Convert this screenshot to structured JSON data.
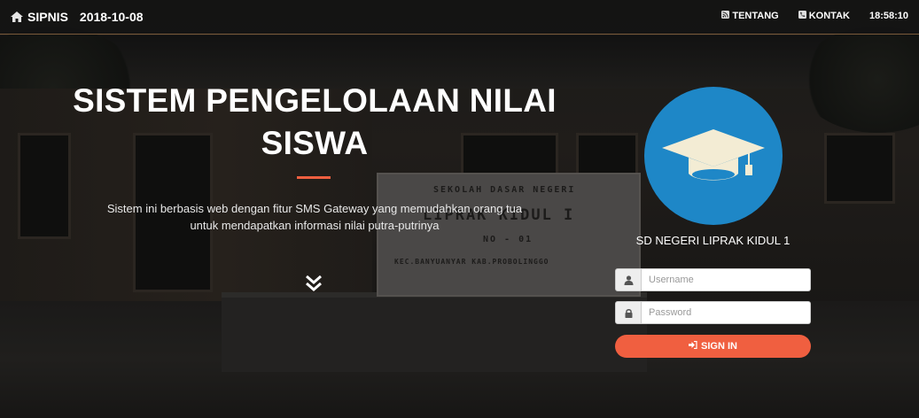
{
  "navbar": {
    "brand": "SIPNIS",
    "date": "2018-10-08",
    "links": [
      {
        "label": "TENTANG",
        "icon": "rss-icon"
      },
      {
        "label": "KONTAK",
        "icon": "phone-icon"
      }
    ],
    "clock": "18:58:10"
  },
  "hero": {
    "title_line1": "SISTEM PENGELOLAAN NILAI",
    "title_line2": "SISWA",
    "subtitle_line1": "Sistem ini berbasis web dengan fitur SMS Gateway yang memudahkan orang tua",
    "subtitle_line2": "untuk mendapatkan informasi nilai putra-putrinya",
    "scroll_icon": "double-chevron-down-icon"
  },
  "background_sign": {
    "line1": "SEKOLAH DASAR NEGERI",
    "line2": "LIPRAK KIDUL I",
    "line3": "NO - 01",
    "line4": "KEC.BANYUANYAR KAB.PROBOLINGGO"
  },
  "login": {
    "logo_icon": "graduation-cap-icon",
    "school_name": "SD NEGERI LIPRAK KIDUL 1",
    "username_placeholder": "Username",
    "password_placeholder": "Password",
    "signin_label": "SIGN IN"
  },
  "colors": {
    "accent": "#f05f40",
    "logo_bg": "#1e87c7",
    "navbar_bg": "#141414"
  }
}
